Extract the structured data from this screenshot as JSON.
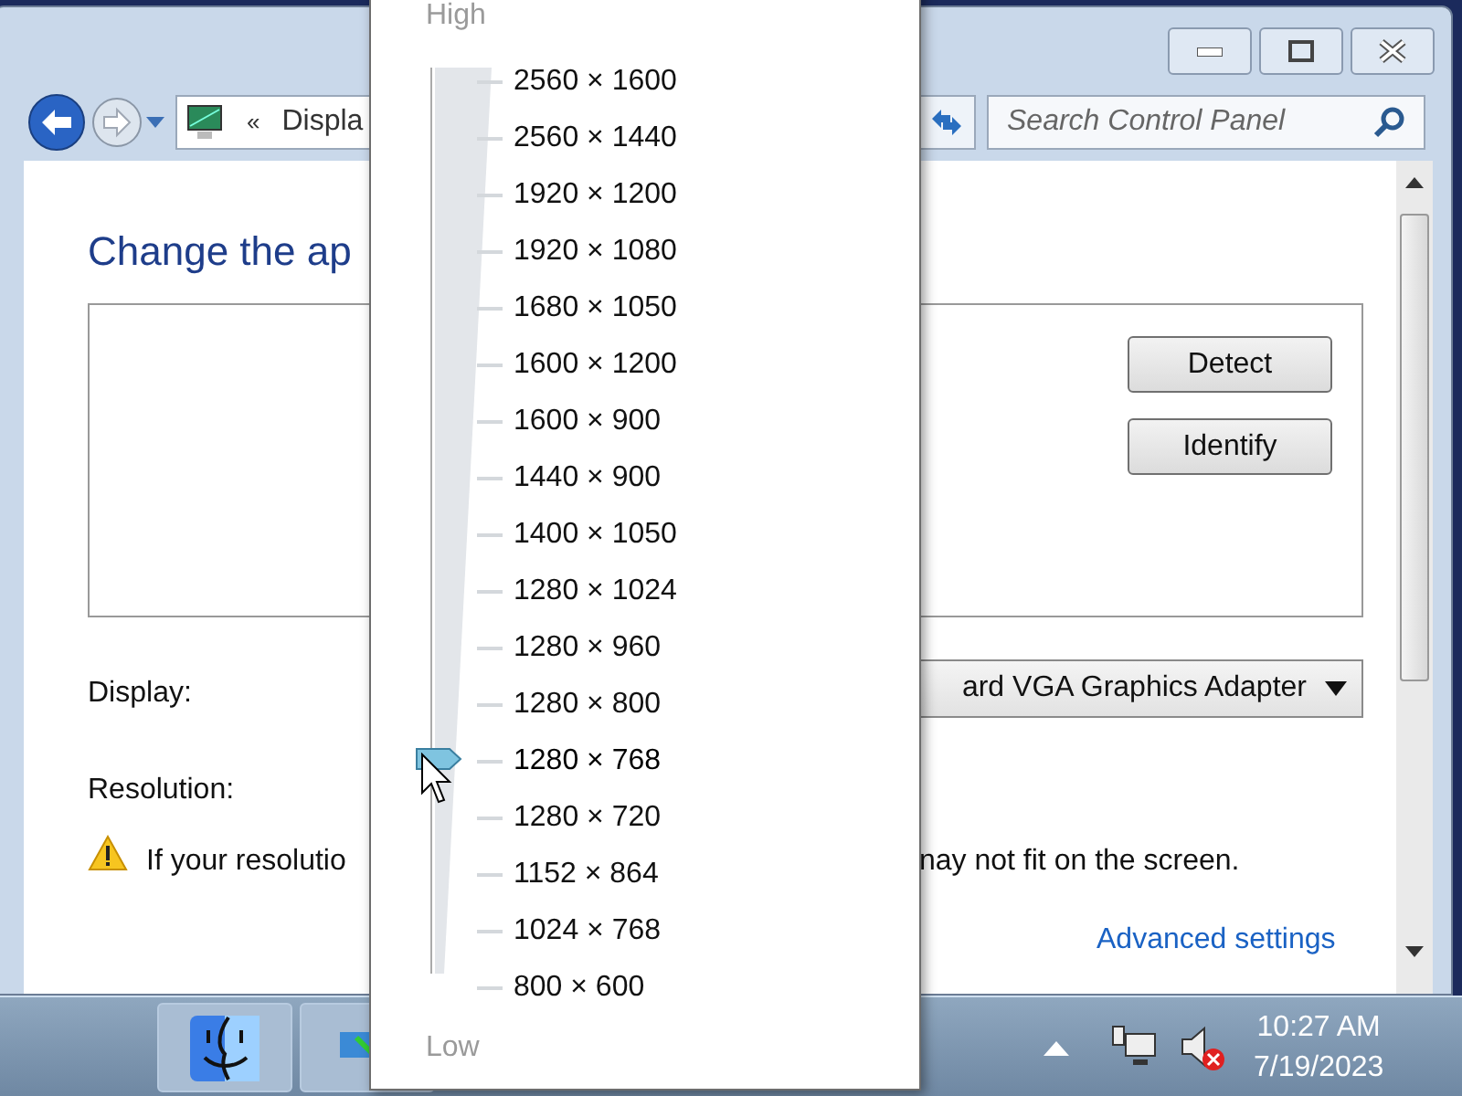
{
  "window": {
    "address": {
      "chevron": "«",
      "crumb": "Displa"
    },
    "search": {
      "placeholder": "Search Control Panel"
    }
  },
  "content": {
    "heading": "Change the ap",
    "buttons": [
      "Detect",
      "Identify"
    ],
    "display_label": "Display:",
    "display_value": "ard VGA Graphics Adapter",
    "resolution_label": "Resolution:",
    "warning": [
      "If your resolutio",
      "nay not fit on the screen."
    ],
    "advanced_link": "Advanced settings"
  },
  "resolution_popup": {
    "high_label": "High",
    "low_label": "Low",
    "items": [
      {
        "label": "2560 × 1600",
        "selected": false
      },
      {
        "label": "2560 × 1440",
        "selected": false
      },
      {
        "label": "1920 × 1200",
        "selected": false
      },
      {
        "label": "1920 × 1080",
        "selected": false
      },
      {
        "label": "1680 × 1050",
        "selected": false
      },
      {
        "label": "1600 × 1200",
        "selected": false
      },
      {
        "label": "1600 × 900",
        "selected": false
      },
      {
        "label": "1440 × 900",
        "selected": false
      },
      {
        "label": "1400 × 1050",
        "selected": false
      },
      {
        "label": "1280 × 1024",
        "selected": false
      },
      {
        "label": "1280 × 960",
        "selected": false
      },
      {
        "label": "1280 × 800",
        "selected": false
      },
      {
        "label": "1280 × 768",
        "selected": true
      },
      {
        "label": "1280 × 720",
        "selected": false
      },
      {
        "label": "1152 × 864",
        "selected": false
      },
      {
        "label": "1024 × 768",
        "selected": false
      },
      {
        "label": "800 × 600",
        "selected": false
      }
    ]
  },
  "taskbar": {
    "clock": {
      "time": "10:27 AM",
      "date": "7/19/2023"
    }
  }
}
